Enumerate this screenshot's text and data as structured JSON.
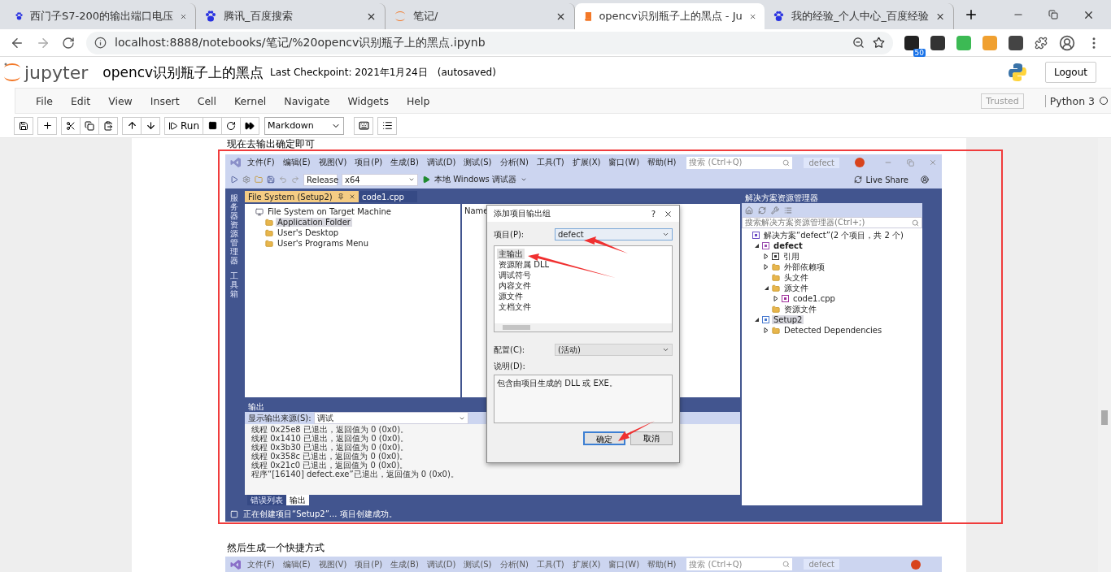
{
  "browser": {
    "tabs": [
      {
        "title": "西门子S7-200的输出端口电压",
        "selected": false
      },
      {
        "title": "腾讯_百度搜索",
        "selected": false
      },
      {
        "title": "笔记/",
        "selected": false
      },
      {
        "title": "opencv识别瓶子上的黑点 - Ju",
        "selected": true
      },
      {
        "title": "我的经验_个人中心_百度经验",
        "selected": false
      }
    ],
    "url": "localhost:8888/notebooks/笔记/%20opencv识别瓶子上的黑点.ipynb",
    "extension_badge": "50"
  },
  "jupyter": {
    "logo": "jupyter",
    "title": "opencv识别瓶子上的黑点",
    "checkpoint": "Last Checkpoint: 2021年1月24日",
    "autosaved": "(autosaved)",
    "logout": "Logout",
    "menu": [
      "File",
      "Edit",
      "View",
      "Insert",
      "Cell",
      "Kernel",
      "Navigate",
      "Widgets",
      "Help"
    ],
    "trusted": "Trusted",
    "kernel": "Python 3",
    "run": "Run",
    "cell_type": "Markdown"
  },
  "notebook": {
    "text_above": "现在去输出确定即可",
    "text_below": "然后生成一个快捷方式"
  },
  "vs": {
    "menu": [
      "文件(F)",
      "编辑(E)",
      "视图(V)",
      "项目(P)",
      "生成(B)",
      "调试(D)",
      "测试(S)",
      "分析(N)",
      "工具(T)",
      "扩展(X)",
      "窗口(W)",
      "帮助(H)"
    ],
    "search_placeholder": "搜索 (Ctrl+Q)",
    "project_badge": "defect",
    "config": "Release",
    "platform": "x64",
    "debugger": "本地 Windows 调试器",
    "live_share": "Live Share",
    "left_strip": [
      "服务器资源管理器",
      "工具箱"
    ],
    "doc_tabs": [
      {
        "label": "File System (Setup2)",
        "selected": true
      },
      {
        "label": "code1.cpp",
        "selected": false
      }
    ],
    "file_tree": [
      {
        "label": "File System on Target Machine",
        "kind": "machine",
        "selected": false,
        "children": [
          {
            "label": "Application Folder",
            "kind": "folder",
            "selected": true
          },
          {
            "label": "User's Desktop",
            "kind": "folder",
            "selected": false
          },
          {
            "label": "User's Programs Menu",
            "kind": "folder",
            "selected": false
          }
        ]
      }
    ],
    "name_header": "Name",
    "dialog": {
      "title": "添加项目输出组",
      "help": "?",
      "project_label": "项目(P):",
      "project_value": "defect",
      "outputs": [
        {
          "label": "主输出",
          "selected": true
        },
        {
          "label": "资源附属 DLL",
          "selected": false
        },
        {
          "label": "调试符号",
          "selected": false
        },
        {
          "label": "内容文件",
          "selected": false
        },
        {
          "label": "源文件",
          "selected": false
        },
        {
          "label": "文档文件",
          "selected": false
        }
      ],
      "config_label": "配置(C):",
      "config_value": "(活动)",
      "desc_label": "说明(D):",
      "desc": "包含由项目生成的 DLL 或 EXE。",
      "ok": "确定",
      "cancel": "取消"
    },
    "output": {
      "title": "输出",
      "source_label": "显示输出来源(S):",
      "source_value": "调试",
      "lines": [
        "线程 0x25e8 已退出，返回值为 0 (0x0)。",
        "线程 0x1410 已退出，返回值为 0 (0x0)。",
        "线程 0x3b30 已退出，返回值为 0 (0x0)。",
        "线程 0x358c 已退出，返回值为 0 (0x0)。",
        "线程 0x21c0 已退出，返回值为 0 (0x0)。",
        "程序“[16140] defect.exe”已退出，返回值为 0 (0x0)。"
      ],
      "tabs": [
        {
          "label": "错误列表",
          "selected": false
        },
        {
          "label": "输出",
          "selected": true
        }
      ]
    },
    "explorer": {
      "title": "解决方案资源管理器",
      "search_placeholder": "搜索解决方案资源管理器(Ctrl+;)",
      "tree": [
        {
          "label": "解决方案“defect”(2 个项目，共 2 个)",
          "kind": "solution",
          "selected": false,
          "children": [
            {
              "label": "defect",
              "kind": "project",
              "bold": true,
              "expanded": true,
              "selected": false,
              "children": [
                {
                  "label": "引用",
                  "kind": "ref",
                  "expanded": false,
                  "selected": false
                },
                {
                  "label": "外部依赖项",
                  "kind": "folder",
                  "expanded": false,
                  "selected": false
                },
                {
                  "label": "头文件",
                  "kind": "folder",
                  "selected": false
                },
                {
                  "label": "源文件",
                  "kind": "folder",
                  "expanded": true,
                  "selected": false,
                  "children": [
                    {
                      "label": "code1.cpp",
                      "kind": "cpp",
                      "expanded": false,
                      "selected": false
                    }
                  ]
                },
                {
                  "label": "资源文件",
                  "kind": "folder",
                  "selected": false
                }
              ]
            },
            {
              "label": "Setup2",
              "kind": "setup",
              "expanded": true,
              "selected": true,
              "children": [
                {
                  "label": "Detected Dependencies",
                  "kind": "folder",
                  "expanded": false,
                  "selected": false
                }
              ]
            }
          ]
        }
      ]
    },
    "status": "正在创建项目“Setup2”... 项目创建成功。"
  },
  "vs2": {
    "menu": [
      "文件(F)",
      "编辑(E)",
      "视图(V)",
      "项目(P)",
      "生成(B)",
      "调试(D)",
      "测试(S)",
      "分析(N)",
      "工具(T)",
      "扩展(X)",
      "窗口(W)",
      "帮助(H)"
    ],
    "search_placeholder": "搜索 (Ctrl+Q)",
    "project_badge": "defect"
  }
}
